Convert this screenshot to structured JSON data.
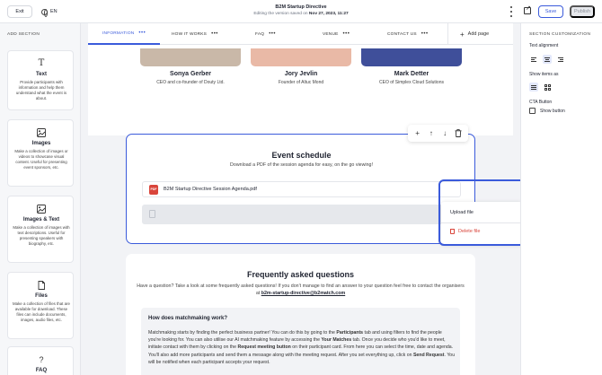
{
  "topbar": {
    "exit_label": "Exit",
    "language": "EN",
    "title": "B2M Startup Directive",
    "saved_prefix": "Editing the version saved on ",
    "saved_date": "Nov 27, 2023, 11:27",
    "save_label": "Save",
    "publish_label": "Publish"
  },
  "left": {
    "title": "ADD SECTION",
    "sections": [
      {
        "name": "Text",
        "icon": "text-icon",
        "desc": "Provide participants with information and help them understand what the event is about."
      },
      {
        "name": "Images",
        "icon": "image-icon",
        "desc": "Make a collection of images or videos to showcase visual content. Useful for presenting event sponsors, etc."
      },
      {
        "name": "Images & Text",
        "icon": "image-text-icon",
        "desc": "Make a collection of images with text descriptions. Useful for presenting speakers with biography, etc."
      },
      {
        "name": "Files",
        "icon": "file-icon",
        "desc": "Make a collection of files that are available for download. These files can include documents, images, audio files, etc."
      },
      {
        "name": "FAQ",
        "icon": "question-icon",
        "desc": ""
      }
    ]
  },
  "tabs": [
    {
      "label": "INFORMATION",
      "active": true
    },
    {
      "label": "HOW IT WORKS",
      "active": false
    },
    {
      "label": "FAQ",
      "active": false
    },
    {
      "label": "VENUE",
      "active": false
    },
    {
      "label": "CONTACT US",
      "active": false
    }
  ],
  "add_page_label": "Add page",
  "speakers": [
    {
      "name": "Sonya Gerber",
      "role": "CEO and co-founder of Douty Ltd.",
      "color": "#c9b8a8"
    },
    {
      "name": "Jory Jevlin",
      "role": "Founder of Altuc Mond",
      "color": "#e9b9a6"
    },
    {
      "name": "Mark Detter",
      "role": "CEO of Simplex Cloud Solutions",
      "color": "#3f4f9a"
    }
  ],
  "schedule": {
    "title": "Event schedule",
    "subtitle": "Download a PDF of the session agenda for easy, on the go viewing!",
    "file_name": "B2M Startup Directive Session Agenda.pdf",
    "pdf_badge": "PDF"
  },
  "menu": {
    "upload_label": "Upload file",
    "delete_label": "Delete file"
  },
  "faq": {
    "title": "Frequently asked questions",
    "intro_text": "Have a question? Take a look at some frequently asked questions! If you don't manage to find an answer to your question feel free to contact the organisers at ",
    "email": "b2m-startup-directive@b2match.com",
    "question": "How does matchmaking work?",
    "answer_parts": [
      "Matchmaking starts by finding the perfect business partner! You can do this by going to the ",
      "Participants",
      " tab and using filters to find the people you're looking for. You can also utilise our AI matchmaking feature by accessing the ",
      "Your Matches",
      " tab. Once you decide who you'd like to meet, initiate contact with them by clicking on the ",
      "Request meeting button",
      " on their participant card. From here you can select the time, date and agenda. You'll also add more participants and send them a message along with the meeting request. After you set everything up, click on ",
      "Send Request",
      ". You will be notified when each participant accepts your request."
    ]
  },
  "right": {
    "title": "SECTION CUSTOMIZATION",
    "text_alignment_label": "Text alignment",
    "show_items_label": "Show items as",
    "cta_label": "CTA Button",
    "show_button_label": "Show button"
  },
  "colors": {
    "accent": "#3b5bdb",
    "danger": "#d9453b"
  }
}
